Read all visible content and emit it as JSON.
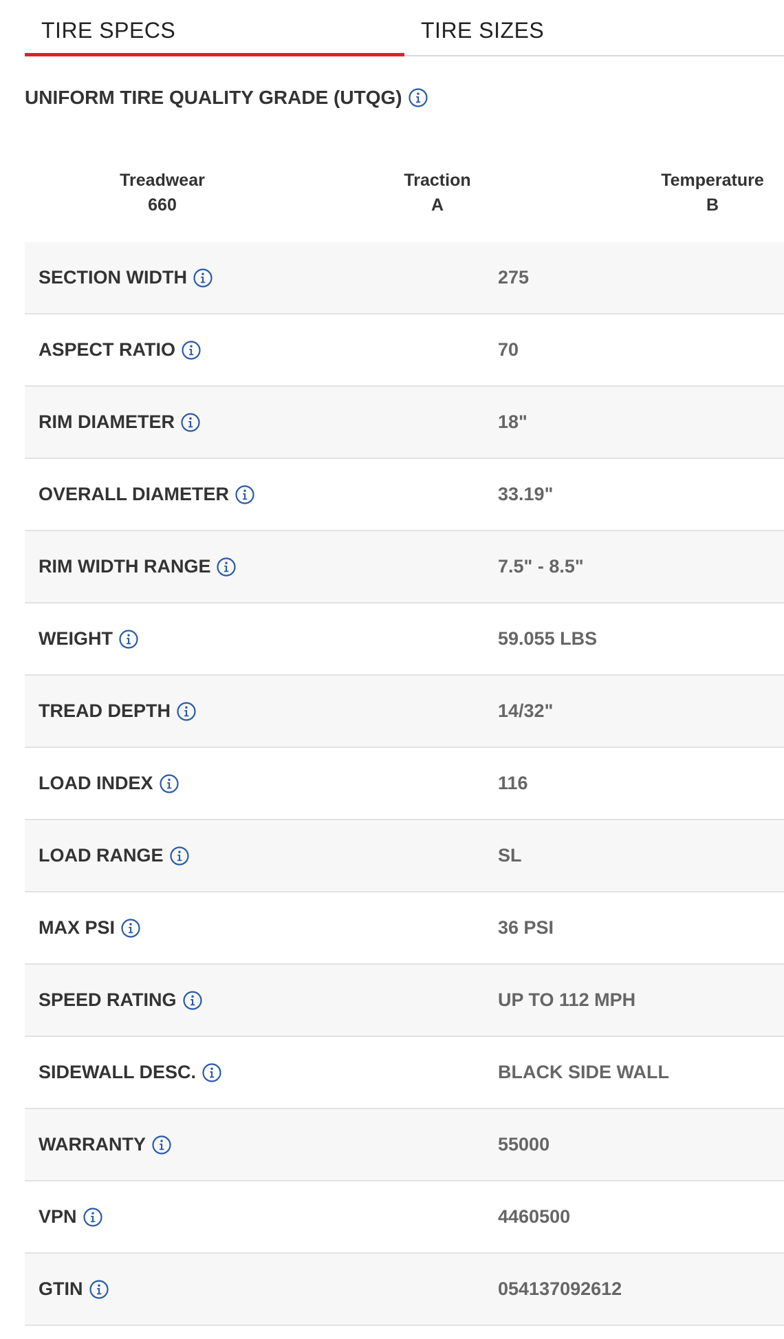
{
  "tabs": [
    {
      "label": "TIRE SPECS",
      "active": true
    },
    {
      "label": "TIRE SIZES",
      "active": false
    }
  ],
  "utqg": {
    "heading": "UNIFORM TIRE QUALITY GRADE (UTQG)",
    "treadwear_label": "Treadwear",
    "treadwear_value": "660",
    "traction_label": "Traction",
    "traction_value": "A",
    "temperature_label": "Temperature",
    "temperature_value": "B"
  },
  "specs": [
    {
      "label": "SECTION WIDTH",
      "value": "275"
    },
    {
      "label": "ASPECT RATIO",
      "value": "70"
    },
    {
      "label": "RIM DIAMETER",
      "value": "18\""
    },
    {
      "label": "OVERALL DIAMETER",
      "value": "33.19\""
    },
    {
      "label": "RIM WIDTH RANGE",
      "value": "7.5\" - 8.5\""
    },
    {
      "label": "WEIGHT",
      "value": "59.055 LBS"
    },
    {
      "label": "TREAD DEPTH",
      "value": "14/32\""
    },
    {
      "label": "LOAD INDEX",
      "value": "116"
    },
    {
      "label": "LOAD RANGE",
      "value": "SL"
    },
    {
      "label": "MAX PSI",
      "value": "36 PSI"
    },
    {
      "label": "SPEED RATING",
      "value": "UP TO 112 MPH"
    },
    {
      "label": "SIDEWALL DESC.",
      "value": "BLACK SIDE WALL"
    },
    {
      "label": "WARRANTY",
      "value": "55000"
    },
    {
      "label": "VPN",
      "value": "4460500"
    },
    {
      "label": "GTIN",
      "value": "054137092612"
    }
  ],
  "colors": {
    "accent": "#d22630",
    "info_icon": "#2a5aa8",
    "row_alt": "#f7f7f7"
  },
  "icons": {
    "info": "info-icon"
  }
}
